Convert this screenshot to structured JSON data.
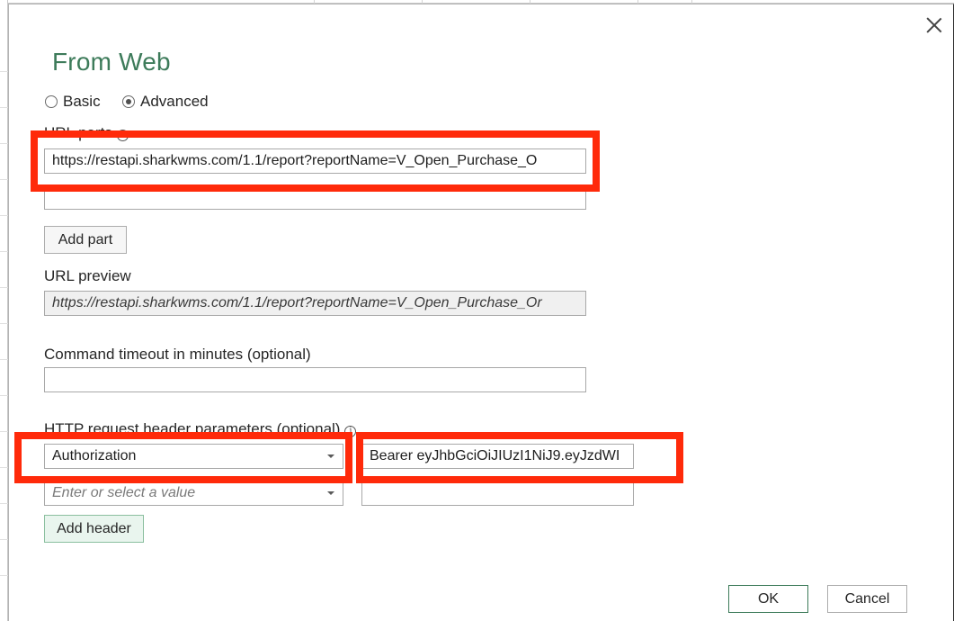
{
  "dialog": {
    "title": "From Web",
    "mode_options": [
      {
        "label": "Basic",
        "selected": false
      },
      {
        "label": "Advanced",
        "selected": true
      }
    ],
    "url_parts_label": "URL parts",
    "url_parts": [
      "https://restapi.sharkwms.com/1.1/report?reportName=V_Open_Purchase_O",
      ""
    ],
    "add_part_label": "Add part",
    "url_preview_label": "URL preview",
    "url_preview_value": "https://restapi.sharkwms.com/1.1/report?reportName=V_Open_Purchase_Or",
    "timeout_label": "Command timeout in minutes (optional)",
    "timeout_value": "",
    "headers_label": "HTTP request header parameters (optional)",
    "headers": [
      {
        "name": "Authorization",
        "value": "Bearer eyJhbGciOiJIUzI1NiJ9.eyJzdWI"
      },
      {
        "name_placeholder": "Enter or select a value",
        "value": ""
      }
    ],
    "add_header_label": "Add header",
    "ok_label": "OK",
    "cancel_label": "Cancel"
  },
  "colors": {
    "title_green": "#3d7b5a",
    "highlight_red": "#ff2a0a"
  },
  "icons": {
    "close": "close-icon",
    "info": "info-icon",
    "dropdown": "chevron-down-icon"
  }
}
